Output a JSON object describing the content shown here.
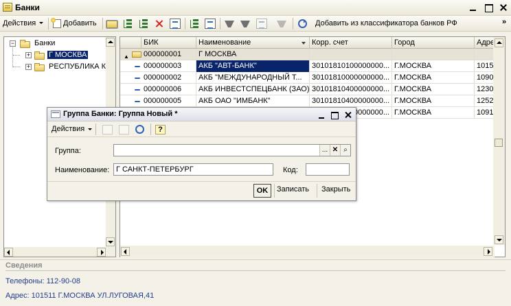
{
  "window": {
    "title": "Банки"
  },
  "toolbar": {
    "actions_label": "Действия",
    "add_label_underlined": "Д",
    "add_label_rest": "обавить",
    "classifier_label": "Добавить из классификатора банков РФ",
    "more_label": "»"
  },
  "tree": {
    "root_label": "Банки",
    "items": [
      {
        "label": "Г МОСКВА"
      },
      {
        "label": "РЕСПУБЛИКА К"
      }
    ]
  },
  "grid": {
    "columns": [
      "БИК",
      "Наименование",
      "Корр. счет",
      "Город",
      "Адрес"
    ],
    "rows": [
      {
        "type": "group",
        "bik": "000000001",
        "name": "Г МОСКВА",
        "account": "",
        "city": "",
        "address": ""
      },
      {
        "type": "item",
        "bik": "000000003",
        "name": "АКБ \"АВТ-БАНК\"",
        "account": "30101810100000000...",
        "city": "Г.МОСКВА",
        "address": "1015"
      },
      {
        "type": "item",
        "bik": "000000002",
        "name": "АКБ \"МЕЖДУНАРОДНЫЙ Т...",
        "account": "30101810000000000...",
        "city": "Г.МОСКВА",
        "address": "1090"
      },
      {
        "type": "item",
        "bik": "000000006",
        "name": "АКБ ИНВЕСТСПЕЦБАНК (ЗАО)",
        "account": "30101810400000000...",
        "city": "Г.МОСКВА",
        "address": "1230"
      },
      {
        "type": "item",
        "bik": "000000005",
        "name": "АКБ ОАО \"ИМБАНК\"",
        "account": "30101810400000000...",
        "city": "Г.МОСКВА",
        "address": "1252"
      },
      {
        "type": "item",
        "bik": "",
        "name": "",
        "account": "00000000...",
        "city": "Г.МОСКВА",
        "address": "1091"
      }
    ]
  },
  "info": {
    "title": "Сведения",
    "phone": "Телефоны: 112-90-08",
    "address": "Адрес: 101511 Г.МОСКВА УЛ.ЛУГОВАЯ,41"
  },
  "dialog": {
    "title": "Группа Банки: Группа Новый *",
    "actions_label": "Действия",
    "help_label": "?",
    "group_label": "Группа:",
    "group_value": "",
    "name_label": "Наименование:",
    "name_value": "Г САНКТ-ПЕТЕРБУРГ",
    "code_label": "Код:",
    "code_value": "",
    "ellipsis_label": "...",
    "ok_label": "OK",
    "write_label": "Записать",
    "close_label": "Закрыть"
  }
}
